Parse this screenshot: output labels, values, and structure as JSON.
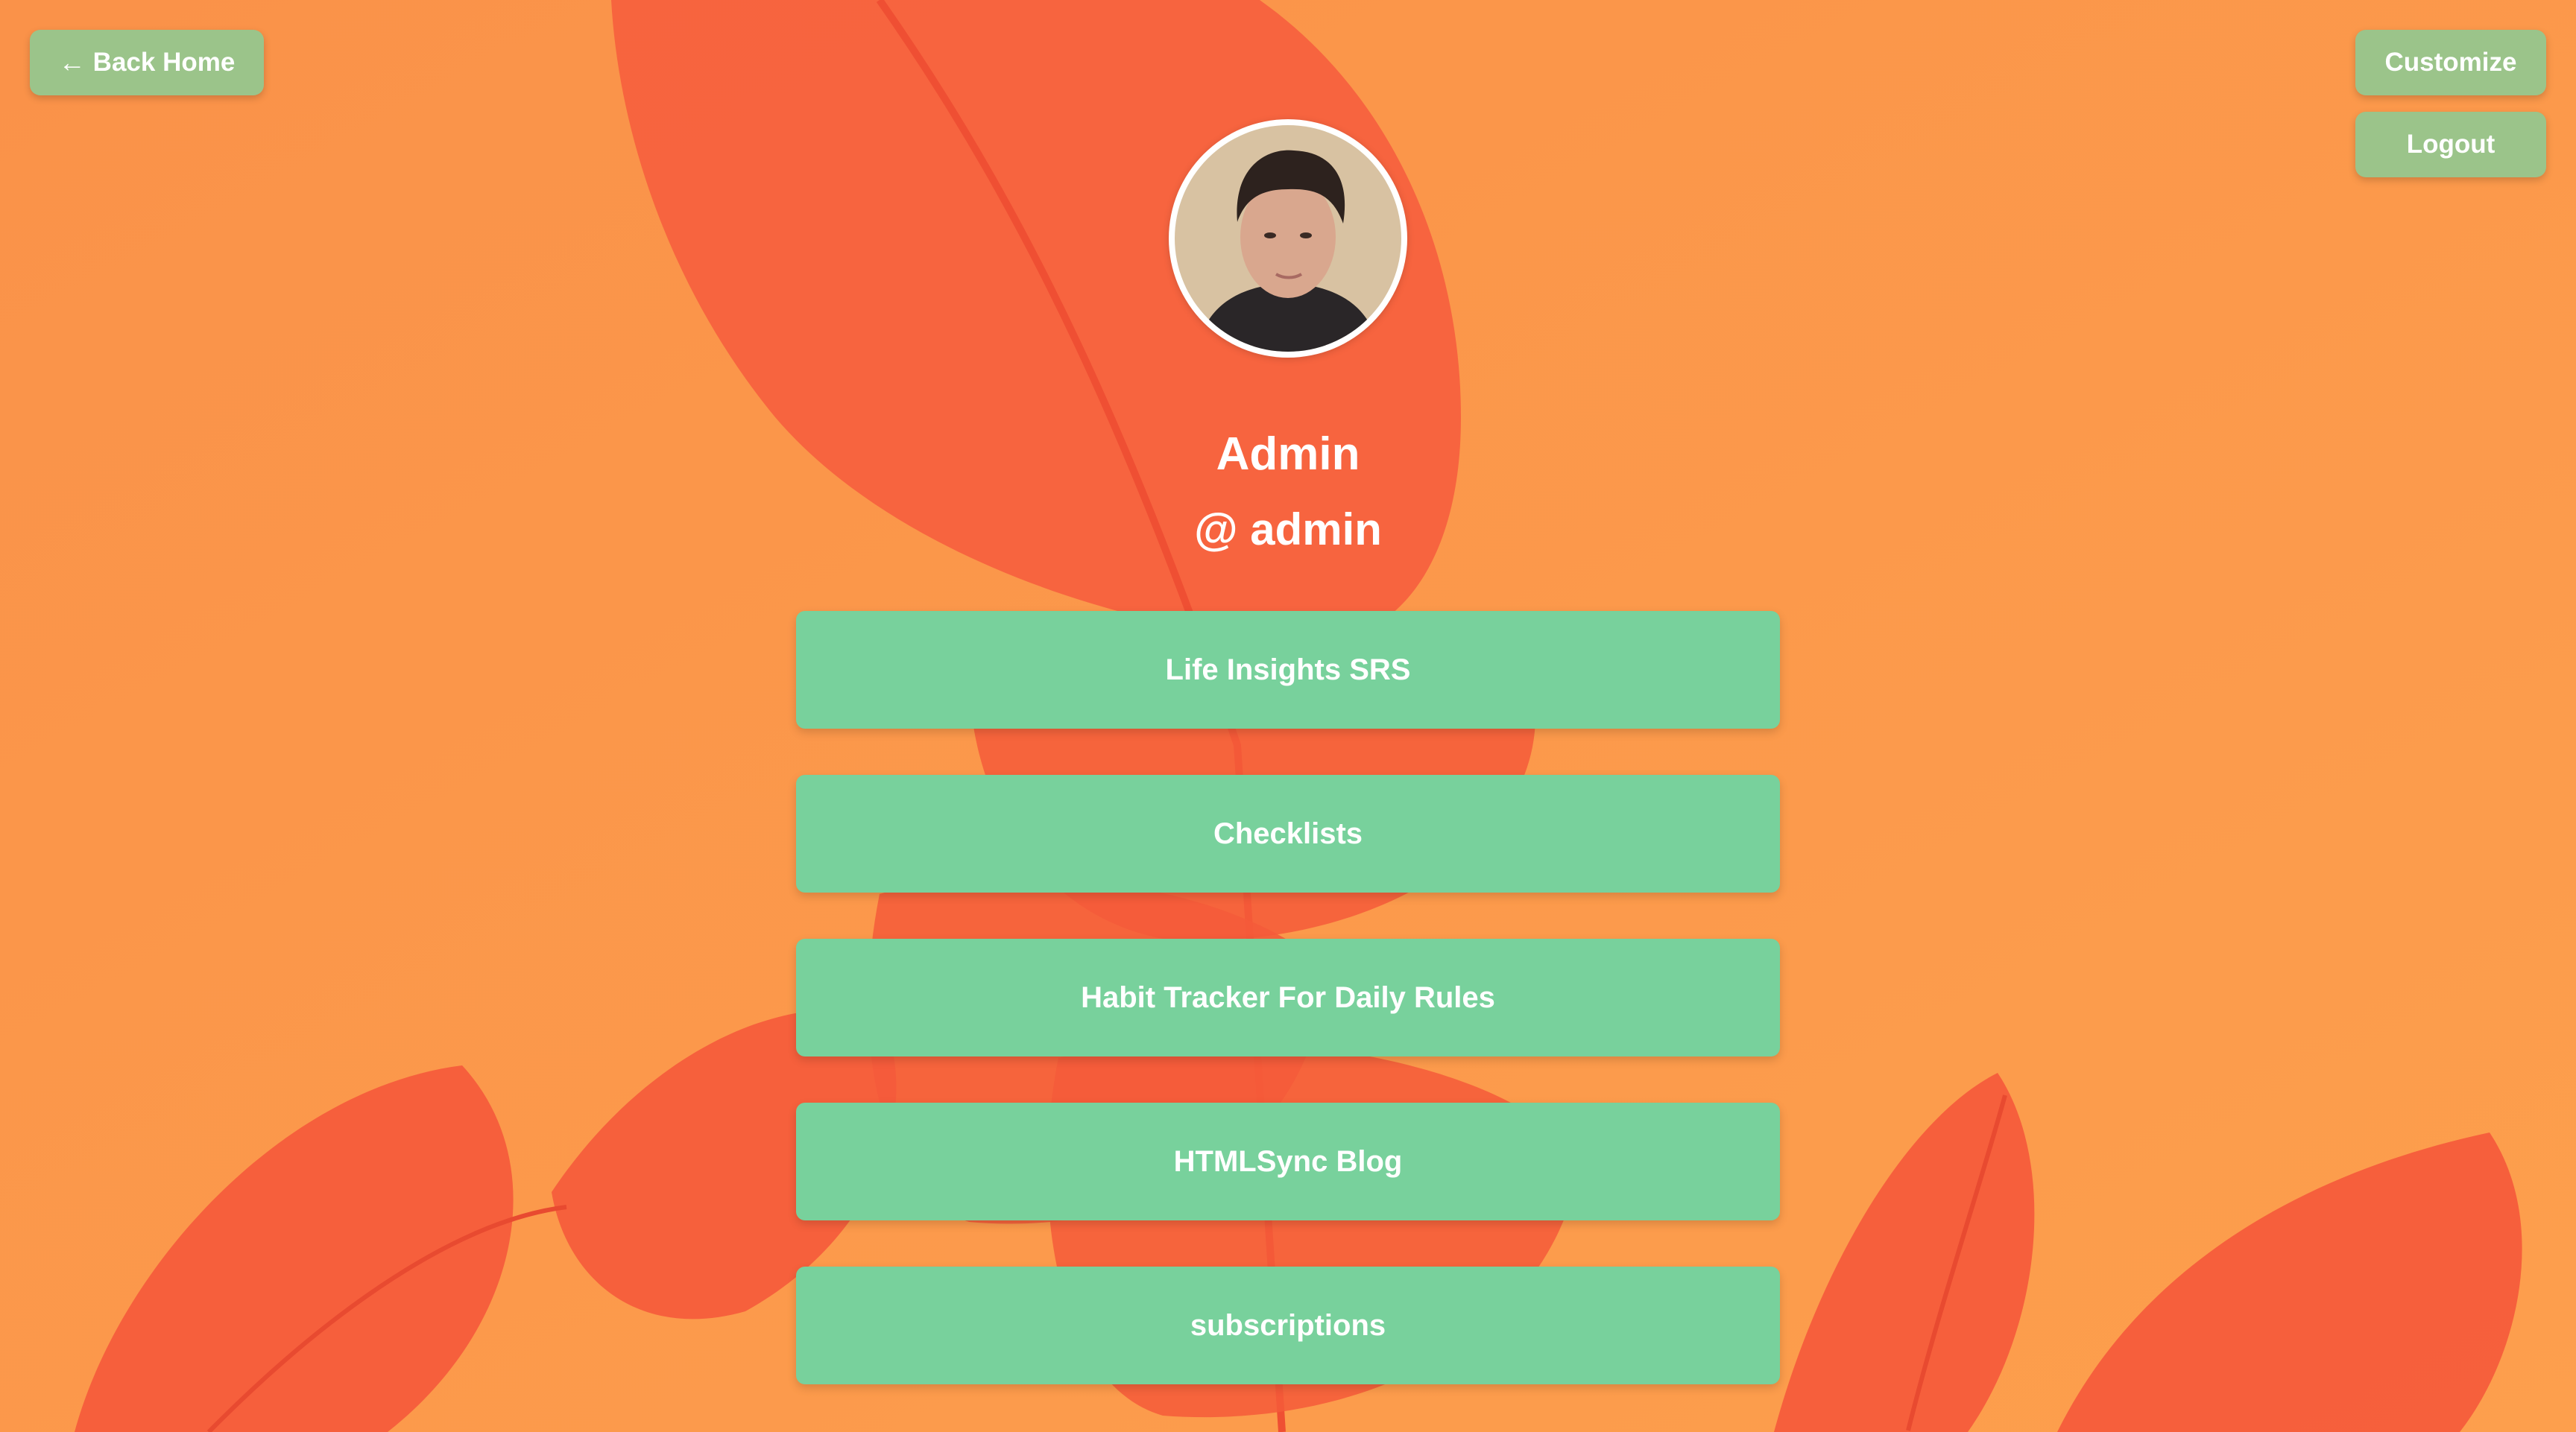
{
  "colors": {
    "background": "#fb9a4c",
    "leaf": "#f65a3c",
    "link_button": "#78d19c",
    "corner_button": "#9bc48a",
    "text": "#ffffff"
  },
  "nav": {
    "back_arrow_icon": "left-arrow",
    "back_label": "Back Home",
    "customize_label": "Customize",
    "logout_label": "Logout"
  },
  "profile": {
    "avatar_icon": "user-avatar",
    "display_name": "Admin",
    "handle": "@ admin"
  },
  "links": [
    {
      "label": "Life Insights SRS"
    },
    {
      "label": "Checklists"
    },
    {
      "label": "Habit Tracker For Daily Rules"
    },
    {
      "label": "HTMLSync Blog"
    },
    {
      "label": "subscriptions"
    }
  ]
}
